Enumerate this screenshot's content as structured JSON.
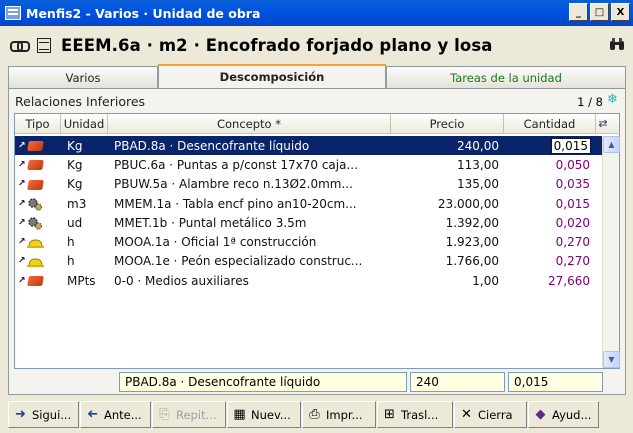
{
  "window": {
    "title": "Menfis2 - Varios · Unidad de obra",
    "controls": [
      "_",
      "□",
      "X"
    ]
  },
  "heading": {
    "code": "EEEM.6a",
    "unit": "m2",
    "text": "EEEM.6a · m2 · Encofrado forjado plano y losa"
  },
  "tabs": [
    {
      "label": "Varios",
      "active": false
    },
    {
      "label": "Descomposición",
      "active": true
    },
    {
      "label": "Tareas de la unidad",
      "active": false
    }
  ],
  "panel": {
    "label": "Relaciones Inferiores",
    "counter": "1 / 8"
  },
  "grid": {
    "columns": [
      "Tipo",
      "Unidad",
      "Concepto *",
      "Precio",
      "Cantidad"
    ],
    "rows": [
      {
        "type": "material",
        "unidad": "Kg",
        "concepto": "PBAD.8a · Desencofrante líquido",
        "precio": "240,00",
        "cantidad": "0,015",
        "selected": true
      },
      {
        "type": "material",
        "unidad": "Kg",
        "concepto": "PBUC.6a · Puntas a p/const 17x70 caja...",
        "precio": "113,00",
        "cantidad": "0,050"
      },
      {
        "type": "material",
        "unidad": "Kg",
        "concepto": "PBUW.5a · Alambre reco n.13Ø2.0mm...",
        "precio": "135,00",
        "cantidad": "0,035"
      },
      {
        "type": "machinery",
        "unidad": "m3",
        "concepto": "MMEM.1a · Tabla encf pino an10-20cm...",
        "precio": "23.000,00",
        "cantidad": "0,015"
      },
      {
        "type": "machinery",
        "unidad": "ud",
        "concepto": "MMET.1b · Puntal metálico 3.5m",
        "precio": "1.392,00",
        "cantidad": "0,020"
      },
      {
        "type": "labor",
        "unidad": "h",
        "concepto": "MOOA.1a · Oficial 1ª construcción",
        "precio": "1.923,00",
        "cantidad": "0,270"
      },
      {
        "type": "labor",
        "unidad": "h",
        "concepto": "MOOA.1e · Peón especializado construc...",
        "precio": "1.766,00",
        "cantidad": "0,270"
      },
      {
        "type": "material",
        "unidad": "MPts",
        "concepto": "0-0 · Medios auxiliares",
        "precio": "1,00",
        "cantidad": "27,660"
      }
    ]
  },
  "editbar": {
    "concepto": "PBAD.8a · Desencofrante líquido",
    "precio": "240",
    "cantidad": "0,015"
  },
  "toolbar": [
    {
      "label": "Sigui...",
      "icon": "arrow-right-icon",
      "enabled": true
    },
    {
      "label": "Ante...",
      "icon": "arrow-left-icon",
      "enabled": true
    },
    {
      "label": "Repit...",
      "icon": "repeat-icon",
      "enabled": false
    },
    {
      "label": "Nuev...",
      "icon": "new-icon",
      "enabled": true
    },
    {
      "label": "Impr...",
      "icon": "printer-icon",
      "enabled": true
    },
    {
      "label": "Trasl...",
      "icon": "transfer-icon",
      "enabled": true
    },
    {
      "label": "Cierra",
      "icon": "close-icon",
      "enabled": true
    },
    {
      "label": "Ayud...",
      "icon": "help-icon",
      "enabled": true
    }
  ],
  "colors": {
    "titlebar": "#0054E3",
    "selection": "#0A246A",
    "quantity": "#800080",
    "tab_green": "#1A7A1A",
    "editbox": "#FFFFE1"
  }
}
